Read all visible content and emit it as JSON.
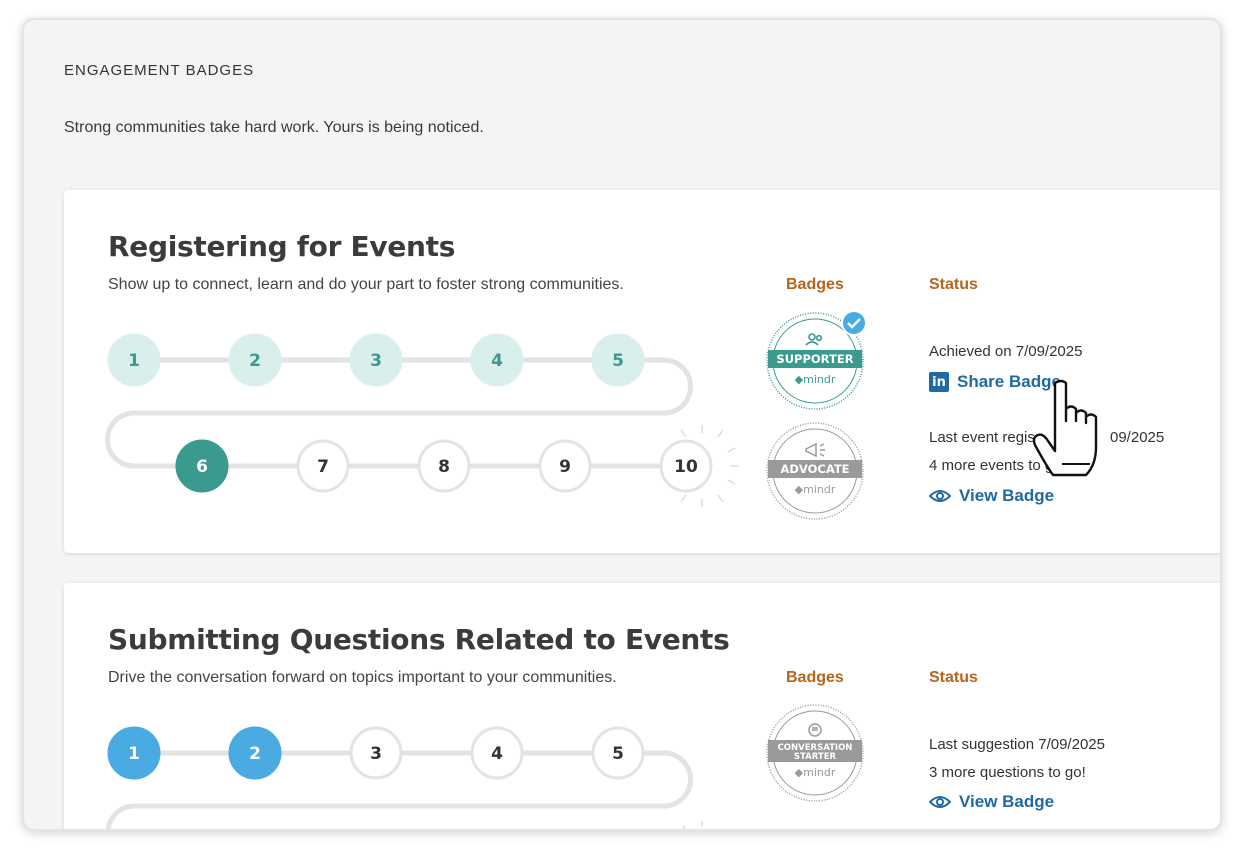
{
  "panel": {
    "title": "ENGAGEMENT BADGES",
    "subtitle": "Strong communities take hard work. Yours is being noticed."
  },
  "cards": [
    {
      "title": "Registering for Events",
      "description": "Show up to connect, learn and do your part to foster strong communities.",
      "badges_header": "Badges",
      "status_header": "Status",
      "steps": [
        "1",
        "2",
        "3",
        "4",
        "5",
        "6",
        "7",
        "8",
        "9",
        "10"
      ],
      "completed_steps": 5,
      "current_step": 6,
      "badges": [
        {
          "name": "SUPPORTER",
          "brand": "mindr",
          "icon": "people-icon",
          "achieved": true
        },
        {
          "name": "ADVOCATE",
          "brand": "mindr",
          "icon": "megaphone-icon",
          "achieved": false
        }
      ],
      "status": {
        "achieved": "Achieved on 7/09/2025",
        "share": "Share Badge",
        "last_event": "Last event regis",
        "last_event_date": "09/2025",
        "remaining": "4 more events to g",
        "view": "View Badge"
      }
    },
    {
      "title": "Submitting Questions Related to Events",
      "description": "Drive the conversation forward on topics important to your communities.",
      "badges_header": "Badges",
      "status_header": "Status",
      "steps": [
        "1",
        "2",
        "3",
        "4",
        "5"
      ],
      "completed_steps": 2,
      "badges": [
        {
          "name": "CONVERSATION STARTER",
          "brand": "mindr",
          "icon": "chat-icon",
          "achieved": false
        }
      ],
      "status": {
        "last": "Last suggestion 7/09/2025",
        "remaining": "3 more questions to go!",
        "view": "View Badge"
      }
    }
  ],
  "colors": {
    "accent_teal": "#3a9a8e",
    "teal_light": "#d8efec",
    "blue": "#4aabe3",
    "link": "#1f6aa5",
    "header_orange": "#b5651d"
  }
}
